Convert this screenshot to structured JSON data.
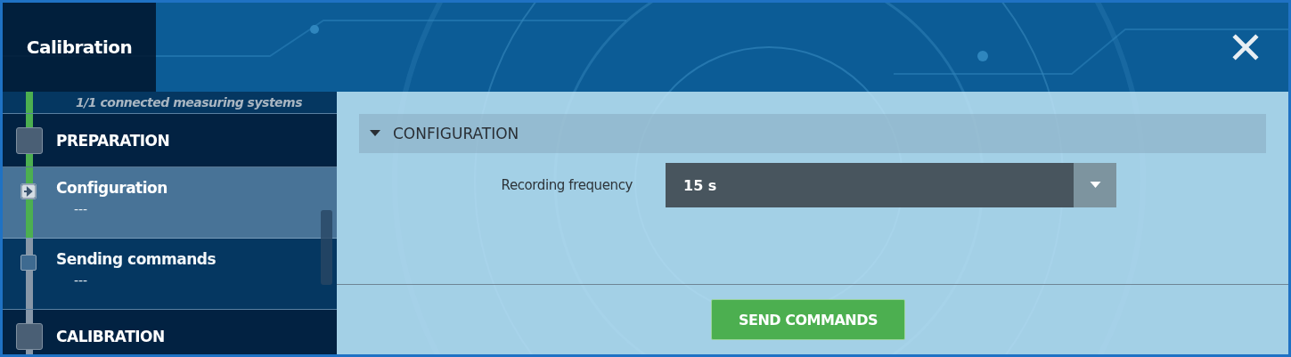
{
  "window": {
    "title": "Calibration"
  },
  "sidebar": {
    "items": [
      {
        "kind": "note",
        "title": "1/1 connected measuring systems",
        "done": true
      },
      {
        "kind": "section",
        "title": "PREPARATION",
        "done": true
      },
      {
        "kind": "step",
        "title": "Configuration",
        "subtitle": "---",
        "done": true,
        "selected": true
      },
      {
        "kind": "step",
        "title": "Sending commands",
        "subtitle": "---",
        "done": false,
        "selected": false
      },
      {
        "kind": "section",
        "title": "CALIBRATION",
        "done": false
      }
    ]
  },
  "content": {
    "section": {
      "title": "CONFIGURATION",
      "expanded": true
    },
    "fields": [
      {
        "label": "Recording frequency",
        "value": "15 s"
      }
    ],
    "button": "SEND COMMANDS"
  }
}
